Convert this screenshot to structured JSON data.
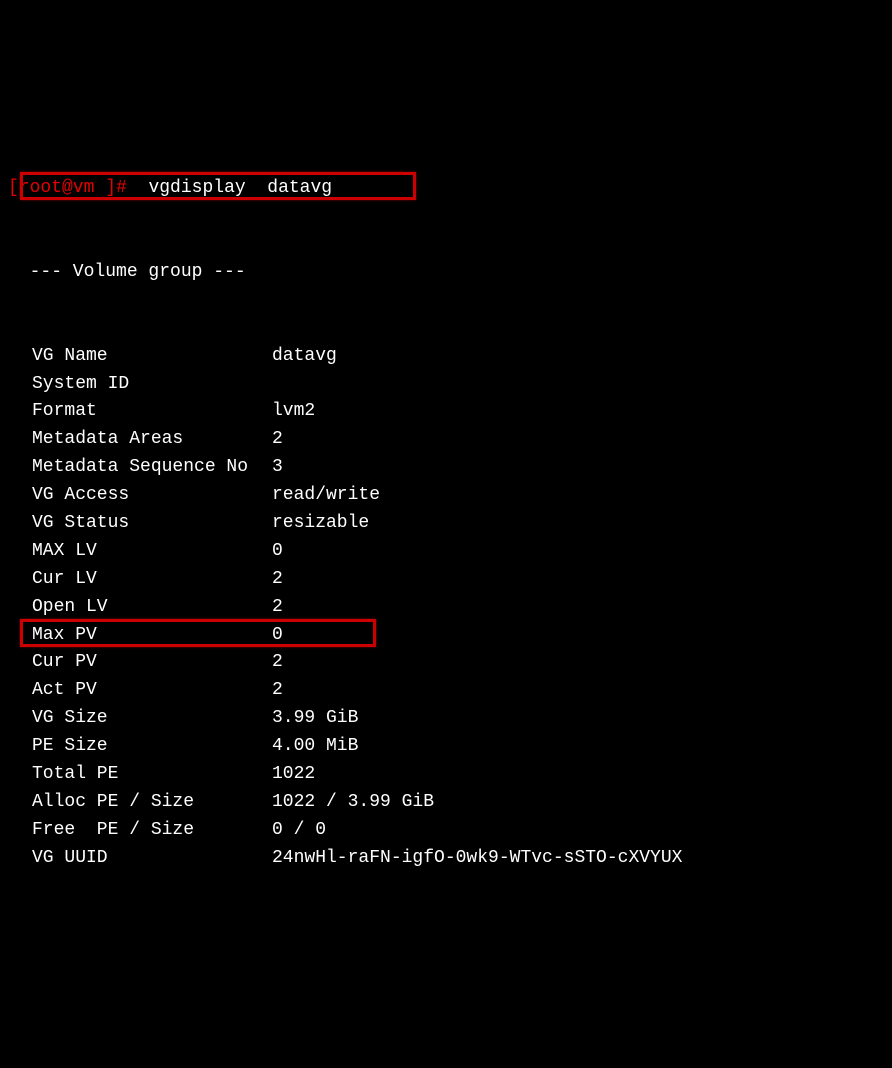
{
  "prompt": {
    "user_host": "[root@vm ]",
    "hash": "#",
    "command": "vgdisplay",
    "argument": "datavg"
  },
  "header": "  --- Volume group ---",
  "rows": [
    {
      "label": "VG Name",
      "value": "datavg",
      "highlighted": true
    },
    {
      "label": "System ID",
      "value": ""
    },
    {
      "label": "Format",
      "value": "lvm2"
    },
    {
      "label": "Metadata Areas",
      "value": "2"
    },
    {
      "label": "Metadata Sequence No",
      "value": "3"
    },
    {
      "label": "VG Access",
      "value": "read/write"
    },
    {
      "label": "VG Status",
      "value": "resizable"
    },
    {
      "label": "MAX LV",
      "value": "0"
    },
    {
      "label": "Cur LV",
      "value": "2"
    },
    {
      "label": "Open LV",
      "value": "2"
    },
    {
      "label": "Max PV",
      "value": "0"
    },
    {
      "label": "Cur PV",
      "value": "2"
    },
    {
      "label": "Act PV",
      "value": "2"
    },
    {
      "label": "VG Size",
      "value": "3.99 GiB"
    },
    {
      "label": "PE Size",
      "value": "4.00 MiB"
    },
    {
      "label": "Total PE",
      "value": "1022"
    },
    {
      "label": "Alloc PE / Size",
      "value": "1022 / 3.99 GiB"
    },
    {
      "label": "Free  PE / Size",
      "value": "0 / 0",
      "highlighted": true
    },
    {
      "label": "VG UUID",
      "value": "24nwHl-raFN-igfO-0wk9-WTvc-sSTO-cXVYUX"
    }
  ]
}
